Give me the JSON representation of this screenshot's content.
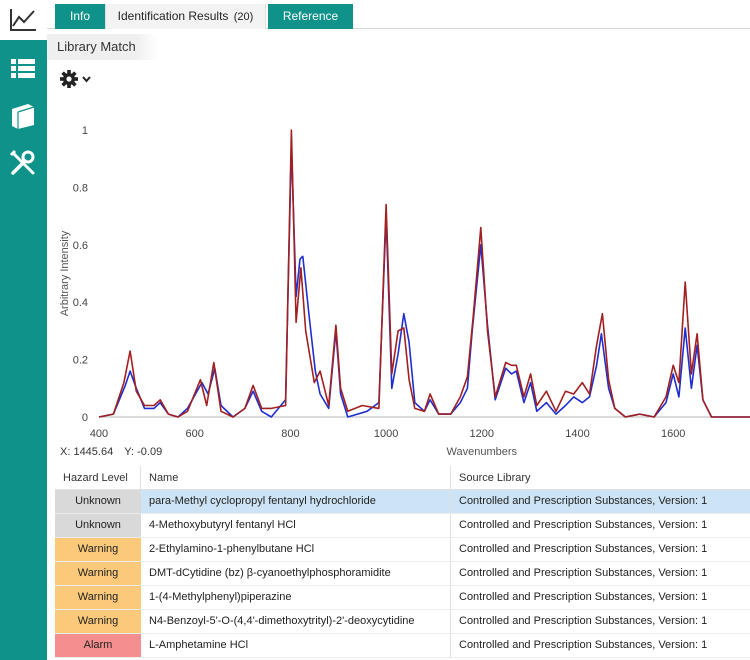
{
  "nav": {
    "top_icon": "line-chart-icon",
    "rail_icons": [
      "list-icon",
      "book-icon",
      "tools-icon"
    ],
    "accent": "#0f9289"
  },
  "tabs": {
    "info": "Info",
    "identification": "Identification Results",
    "identification_count": "(20)",
    "reference": "Reference"
  },
  "section": {
    "title": "Library Match",
    "settings_icon": "gear-icon"
  },
  "chart_data": {
    "type": "line",
    "xlabel": "Wavenumbers",
    "ylabel": "Arbitrary Intensity",
    "xlim": [
      400,
      1850
    ],
    "ylim": [
      0,
      1
    ],
    "x_ticks": [
      "400",
      "600",
      "800",
      "1000",
      "1200",
      "1400",
      "1600"
    ],
    "y_ticks": [
      "0",
      "0.2",
      "0.4",
      "0.6",
      "0.8",
      "1"
    ],
    "grid": false,
    "series": [
      {
        "color": "#1f2fcf",
        "points": [
          [
            400,
            0
          ],
          [
            430,
            0.01
          ],
          [
            455,
            0.11
          ],
          [
            465,
            0.16
          ],
          [
            478,
            0.1
          ],
          [
            495,
            0.03
          ],
          [
            515,
            0.03
          ],
          [
            528,
            0.05
          ],
          [
            545,
            0.01
          ],
          [
            565,
            0
          ],
          [
            585,
            0.03
          ],
          [
            615,
            0.12
          ],
          [
            628,
            0.08
          ],
          [
            642,
            0.17
          ],
          [
            655,
            0.04
          ],
          [
            680,
            0
          ],
          [
            705,
            0.03
          ],
          [
            722,
            0.09
          ],
          [
            740,
            0.02
          ],
          [
            760,
            0
          ],
          [
            790,
            0.06
          ],
          [
            802,
            0.95
          ],
          [
            812,
            0.42
          ],
          [
            820,
            0.55
          ],
          [
            826,
            0.56
          ],
          [
            840,
            0.34
          ],
          [
            852,
            0.16
          ],
          [
            862,
            0.08
          ],
          [
            880,
            0.03
          ],
          [
            895,
            0.3
          ],
          [
            905,
            0.08
          ],
          [
            920,
            0
          ],
          [
            960,
            0.02
          ],
          [
            985,
            0.05
          ],
          [
            1000,
            0.7
          ],
          [
            1012,
            0.1
          ],
          [
            1025,
            0.22
          ],
          [
            1037,
            0.36
          ],
          [
            1048,
            0.26
          ],
          [
            1060,
            0.05
          ],
          [
            1080,
            0.02
          ],
          [
            1092,
            0.06
          ],
          [
            1110,
            0.01
          ],
          [
            1135,
            0.01
          ],
          [
            1155,
            0.05
          ],
          [
            1170,
            0.1
          ],
          [
            1180,
            0.3
          ],
          [
            1198,
            0.6
          ],
          [
            1212,
            0.32
          ],
          [
            1228,
            0.06
          ],
          [
            1250,
            0.17
          ],
          [
            1262,
            0.15
          ],
          [
            1272,
            0.16
          ],
          [
            1288,
            0.05
          ],
          [
            1302,
            0.12
          ],
          [
            1315,
            0.02
          ],
          [
            1335,
            0.05
          ],
          [
            1355,
            0.01
          ],
          [
            1375,
            0.04
          ],
          [
            1392,
            0.07
          ],
          [
            1410,
            0.05
          ],
          [
            1425,
            0.07
          ],
          [
            1440,
            0.18
          ],
          [
            1450,
            0.29
          ],
          [
            1465,
            0.1
          ],
          [
            1478,
            0.03
          ],
          [
            1500,
            0
          ],
          [
            1530,
            0.01
          ],
          [
            1560,
            0
          ],
          [
            1585,
            0.05
          ],
          [
            1600,
            0.15
          ],
          [
            1612,
            0.07
          ],
          [
            1625,
            0.31
          ],
          [
            1638,
            0.1
          ],
          [
            1650,
            0.25
          ],
          [
            1662,
            0.06
          ],
          [
            1680,
            0
          ],
          [
            1850,
            0
          ]
        ]
      },
      {
        "color": "#a32020",
        "points": [
          [
            400,
            0
          ],
          [
            430,
            0.01
          ],
          [
            452,
            0.12
          ],
          [
            465,
            0.23
          ],
          [
            478,
            0.09
          ],
          [
            495,
            0.04
          ],
          [
            515,
            0.04
          ],
          [
            528,
            0.06
          ],
          [
            545,
            0.01
          ],
          [
            565,
            0
          ],
          [
            585,
            0.02
          ],
          [
            612,
            0.13
          ],
          [
            625,
            0.04
          ],
          [
            640,
            0.19
          ],
          [
            655,
            0.02
          ],
          [
            680,
            0
          ],
          [
            705,
            0.03
          ],
          [
            722,
            0.11
          ],
          [
            740,
            0.03
          ],
          [
            760,
            0.03
          ],
          [
            790,
            0.04
          ],
          [
            802,
            1.0
          ],
          [
            812,
            0.33
          ],
          [
            822,
            0.52
          ],
          [
            832,
            0.3
          ],
          [
            850,
            0.12
          ],
          [
            862,
            0.16
          ],
          [
            880,
            0.04
          ],
          [
            895,
            0.32
          ],
          [
            905,
            0.1
          ],
          [
            920,
            0.02
          ],
          [
            950,
            0.04
          ],
          [
            985,
            0.03
          ],
          [
            1000,
            0.74
          ],
          [
            1012,
            0.15
          ],
          [
            1025,
            0.3
          ],
          [
            1037,
            0.31
          ],
          [
            1048,
            0.13
          ],
          [
            1060,
            0.03
          ],
          [
            1080,
            0.02
          ],
          [
            1092,
            0.08
          ],
          [
            1110,
            0.01
          ],
          [
            1135,
            0.01
          ],
          [
            1155,
            0.07
          ],
          [
            1170,
            0.14
          ],
          [
            1182,
            0.35
          ],
          [
            1198,
            0.66
          ],
          [
            1212,
            0.3
          ],
          [
            1228,
            0.07
          ],
          [
            1250,
            0.19
          ],
          [
            1262,
            0.18
          ],
          [
            1272,
            0.18
          ],
          [
            1288,
            0.07
          ],
          [
            1302,
            0.15
          ],
          [
            1315,
            0.04
          ],
          [
            1335,
            0.09
          ],
          [
            1355,
            0.02
          ],
          [
            1375,
            0.09
          ],
          [
            1392,
            0.08
          ],
          [
            1410,
            0.12
          ],
          [
            1425,
            0.08
          ],
          [
            1440,
            0.25
          ],
          [
            1452,
            0.36
          ],
          [
            1465,
            0.13
          ],
          [
            1478,
            0.03
          ],
          [
            1500,
            0
          ],
          [
            1530,
            0.01
          ],
          [
            1560,
            0
          ],
          [
            1585,
            0.07
          ],
          [
            1600,
            0.18
          ],
          [
            1612,
            0.12
          ],
          [
            1625,
            0.47
          ],
          [
            1638,
            0.15
          ],
          [
            1650,
            0.29
          ],
          [
            1662,
            0.06
          ],
          [
            1680,
            0
          ],
          [
            1850,
            0
          ]
        ]
      }
    ]
  },
  "cursor": {
    "x_text": "X: 1445.64",
    "y_text": "Y: -0.09"
  },
  "table": {
    "headers": [
      "Hazard Level",
      "Name",
      "Source Library"
    ],
    "rows": [
      {
        "hazard": "Unknown",
        "name": "para-Methyl cyclopropyl fentanyl hydrochloride",
        "source": "Controlled and Prescription Substances, Version: 1"
      },
      {
        "hazard": "Unknown",
        "name": "4-Methoxybutyryl fentanyl HCl",
        "source": "Controlled and Prescription Substances, Version: 1"
      },
      {
        "hazard": "Warning",
        "name": "2-Ethylamino-1-phenylbutane HCl",
        "source": "Controlled and Prescription Substances, Version: 1"
      },
      {
        "hazard": "Warning",
        "name": "DMT-dCytidine (bz)  β-cyanoethylphosphoramidite",
        "source": "Controlled and Prescription Substances, Version: 1"
      },
      {
        "hazard": "Warning",
        "name": "1-(4-Methylphenyl)piperazine",
        "source": "Controlled and Prescription Substances, Version: 1"
      },
      {
        "hazard": "Warning",
        "name": "N4-Benzoyl-5'-O-(4,4'-dimethoxytrityl)-2'-deoxycytidine",
        "source": "Controlled and Prescription Substances, Version: 1"
      },
      {
        "hazard": "Alarm",
        "name": "L-Amphetamine HCl",
        "source": "Controlled and Prescription Substances, Version: 1"
      }
    ]
  }
}
